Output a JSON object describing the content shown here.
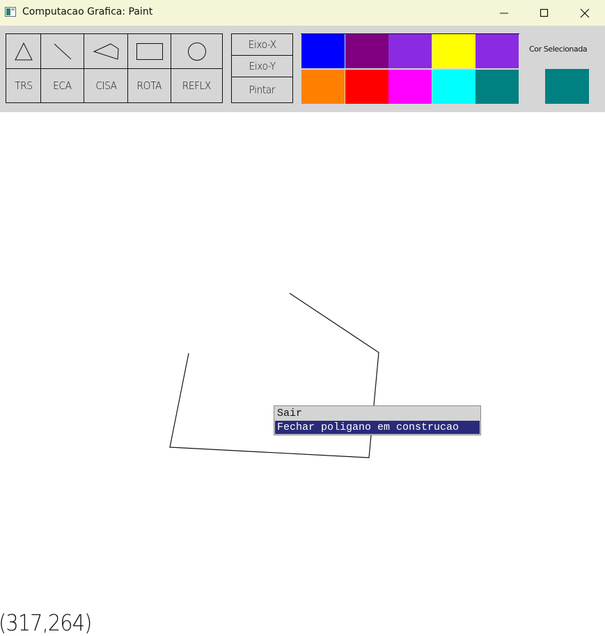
{
  "window": {
    "title": "Computacao Grafica: Paint",
    "controls": [
      "minimize",
      "maximize",
      "close"
    ]
  },
  "toolbar": {
    "shapes": [
      {
        "icon": "triangle-icon"
      },
      {
        "icon": "line-icon"
      },
      {
        "icon": "polygon-icon"
      },
      {
        "icon": "rectangle-icon"
      },
      {
        "icon": "circle-icon"
      }
    ],
    "transforms": [
      "TRS",
      "ECA",
      "CISA",
      "ROTA",
      "REFLX"
    ],
    "axis": {
      "x_label": "Eixo-X",
      "y_label": "Eixo-Y",
      "paint_label": "Pintar"
    },
    "palette": [
      "#0000ff",
      "#800080",
      "#8a2be2",
      "#ffff00",
      "#8a2be2",
      "#ff8000",
      "#ff0000",
      "#ff00ff",
      "#00ffff",
      "#008080"
    ],
    "selected": {
      "label": "Cor Selecionada",
      "color": "#008080"
    }
  },
  "context_menu": {
    "items": [
      {
        "label": "Sair",
        "highlighted": false
      },
      {
        "label": "Fechar poligano em construcao",
        "highlighted": true
      }
    ]
  },
  "status": {
    "coordinates": "(317,264)"
  }
}
